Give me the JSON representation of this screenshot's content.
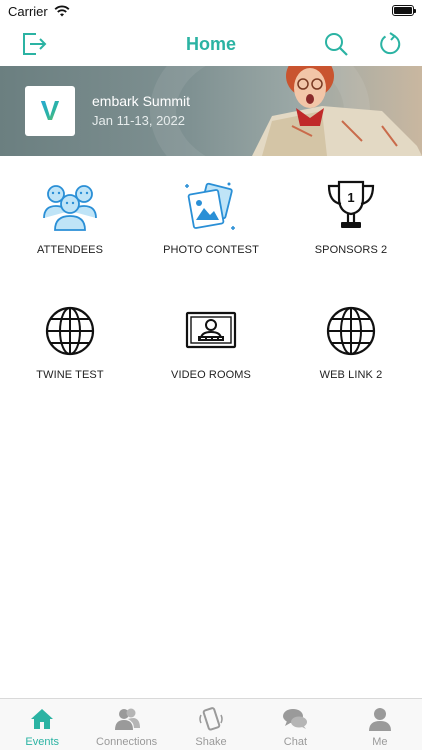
{
  "status": {
    "carrier": "Carrier"
  },
  "nav": {
    "title": "Home"
  },
  "event": {
    "logo_letter": "V",
    "name": "embark Summit",
    "dates": "Jan 11-13, 2022"
  },
  "tiles": [
    {
      "label": "ATTENDEES",
      "icon": "attendees-icon"
    },
    {
      "label": "PHOTO CONTEST",
      "icon": "photo-contest-icon"
    },
    {
      "label": "SPONSORS 2",
      "icon": "trophy-icon"
    },
    {
      "label": "TWINE TEST",
      "icon": "globe-icon"
    },
    {
      "label": "VIDEO ROOMS",
      "icon": "video-room-icon"
    },
    {
      "label": "WEB LINK 2",
      "icon": "globe-icon"
    }
  ],
  "tabs": [
    {
      "label": "Events",
      "icon": "home-icon",
      "active": true
    },
    {
      "label": "Connections",
      "icon": "connections-icon",
      "active": false
    },
    {
      "label": "Shake",
      "icon": "shake-phone-icon",
      "active": false
    },
    {
      "label": "Chat",
      "icon": "chat-bubbles-icon",
      "active": false
    },
    {
      "label": "Me",
      "icon": "person-icon",
      "active": false
    }
  ],
  "colors": {
    "accent": "#2bb3a3",
    "inactive": "#9a9a9a",
    "icon_blue": "#2a8fd6"
  }
}
